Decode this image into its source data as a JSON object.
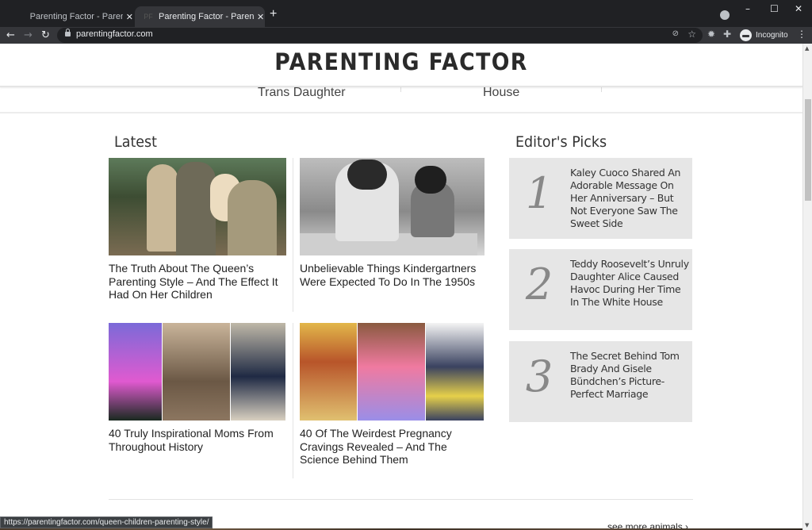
{
  "browser": {
    "tabs": [
      {
        "title": "Parenting Factor - Parenting Factor",
        "active": false
      },
      {
        "title": "Parenting Factor - Parenting Factor",
        "active": true,
        "favicon_text": "PF"
      }
    ],
    "new_tab_label": "+",
    "close_glyph": "✕",
    "url": "parentingfactor.com",
    "profile_label": "Incognito",
    "window_controls": {
      "minimize": "–",
      "maximize": "☐",
      "close": "✕"
    },
    "nav": {
      "back": "←",
      "forward": "→",
      "reload": "↻"
    },
    "icons": {
      "eye_off": "⊘",
      "star": "☆",
      "extension1": "✹",
      "extension2": "✚",
      "menu": "⋮"
    }
  },
  "site": {
    "logo": "PARENTING FACTOR",
    "peek_items": [
      "Trans Daughter",
      "House"
    ]
  },
  "latest": {
    "title": "Latest",
    "articles": [
      {
        "title": "The Truth About The Queen’s Parenting Style – And The Effect It Had On Her Children"
      },
      {
        "title": "Unbelievable Things Kindergartners Were Expected To Do In The 1950s"
      },
      {
        "title": "40 Truly Inspirational Moms From Throughout History"
      },
      {
        "title": "40 Of The Weirdest Pregnancy Cravings Revealed – And The Science Behind Them"
      }
    ]
  },
  "editors_picks": {
    "title": "Editor's Picks",
    "items": [
      {
        "rank": "1",
        "title": "Kaley Cuoco Shared An Adorable Message On Her Anniversary – But Not Everyone Saw The Sweet Side"
      },
      {
        "rank": "2",
        "title": "Teddy Roosevelt’s Unruly Daughter Alice Caused Havoc During Her Time In The White House"
      },
      {
        "rank": "3",
        "title": "The Secret Behind Tom Brady And Gisele Bündchen’s Picture-Perfect Marriage"
      }
    ]
  },
  "see_more": "see more animals ›",
  "status_url": "https://parentingfactor.com/queen-children-parenting-style/",
  "scrollbar": {
    "up": "▲",
    "down": "▼"
  }
}
